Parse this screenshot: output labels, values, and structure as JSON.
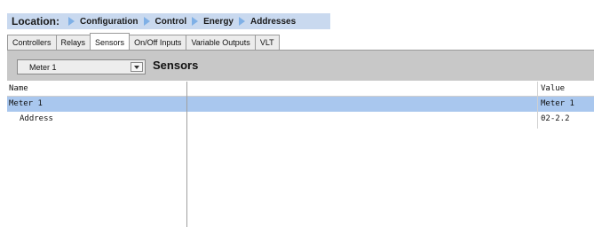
{
  "breadcrumb": {
    "location_label": "Location:",
    "items": [
      "Configuration",
      "Control",
      "Energy",
      "Addresses"
    ]
  },
  "tabs": [
    "Controllers",
    "Relays",
    "Sensors",
    "On/Off Inputs",
    "Variable Outputs",
    "VLT"
  ],
  "active_tab": "Sensors",
  "toolbar": {
    "meter_select_value": "Meter 1",
    "section_title": "Sensors"
  },
  "table": {
    "columns": {
      "name": "Name",
      "value": "Value"
    },
    "rows": [
      {
        "name": "Meter 1",
        "value": "Meter 1",
        "selected": true
      },
      {
        "name": "Address",
        "value": "02-2.2",
        "selected": false
      }
    ]
  },
  "colors": {
    "breadcrumb_bg": "#c9d9ef",
    "selected_row": "#a9c7ee",
    "toolbar_bg": "#c8c8c8",
    "arrow": "#7fb0e6"
  }
}
